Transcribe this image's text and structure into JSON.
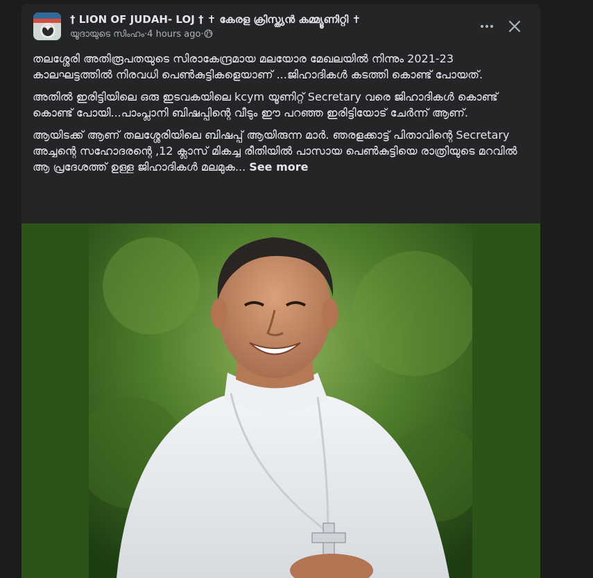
{
  "post": {
    "author": "† LION OF JUDAH- LOJ † ✝ കേരള ക്രിസ്ത്യൻ കമ്മ്യൂണിറ്റി ✝",
    "sub_author": "യൂദായുടെ സിംഹം",
    "separator": " · ",
    "time": "4 hours ago",
    "separator2": " · ",
    "paragraphs": [
      "തലശ്ശേരി അതിരൂപതയുടെ സിരാകേന്ദ്രമായ മലയോര മേഖലയിൽ നിന്നും 2021-23 കാലഘട്ടത്തിൽ നിരവധി പെൺകുട്ടികളെയാണ് ...ജിഹാദികൾ കടത്തി കൊണ്ട് പോയത്.",
      "അതിൽ ഇരിട്ടിയിലെ ഒരു ഇടവകയിലെ kcym യൂണിറ്റ് Secretary വരെ ജിഹാദികൾ കൊണ്ട് കൊണ്ട് പോയി...പാംപ്ലാനി ബിഷപ്പിന്റെ വീടും ഈ പറഞ്ഞ ഇരിട്ടിയോട് ചേർന്ന് ആണ്.",
      "ആയിടക്ക് ആണ് തലശ്ശേരിയിലെ ബിഷപ്പ് ആയിരുന്ന മാർ. ഞരളക്കാട്ട് പിതാവിന്റെ Secretary അച്ചന്റെ  സഹോദരന്റെ ,12 ക്ലാസ്  മികച്ച രീതിയിൽ പാസായ പെൺകുട്ടിയെ  രാത്രിയുടെ മറവിൽ ആ പ്രദേശത്ത് ഉള്ള ജിഹാദികൾ മലമുക..."
    ],
    "see_more": "See more"
  },
  "icons": {
    "more": "more-horizontal-icon",
    "close": "close-icon",
    "privacy": "globe-icon"
  },
  "colors": {
    "card_bg": "#242526",
    "photo_bg": "#2d5418",
    "text": "#e4e6eb",
    "secondary_text": "#b0b3b8"
  }
}
